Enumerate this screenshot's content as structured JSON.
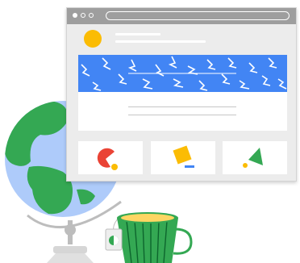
{
  "illustration": {
    "browser_window": {
      "titlebar_icons": [
        "window-dot",
        "window-dot-outline",
        "window-dot-outline"
      ],
      "avatar_color": "#fbbc04",
      "banner_color": "#4285f4",
      "frame_color": "#ececec",
      "titlebar_color": "#9e9e9e"
    },
    "feature_tiles": [
      {
        "icon": "pie-chart-icon",
        "colors": [
          "#ea4335",
          "#fbbc04"
        ]
      },
      {
        "icon": "square-shape-icon",
        "colors": [
          "#fbbc04",
          "#4285f4"
        ]
      },
      {
        "icon": "triangle-shape-icon",
        "colors": [
          "#34a853",
          "#fbbc04"
        ]
      }
    ],
    "globe": {
      "icon": "globe-icon",
      "land_color": "#34a853",
      "water_color": "#aecbfa"
    },
    "teacup": {
      "icon": "teacup-icon",
      "cup_color": "#34a853",
      "tea_color": "#fdd663"
    }
  }
}
